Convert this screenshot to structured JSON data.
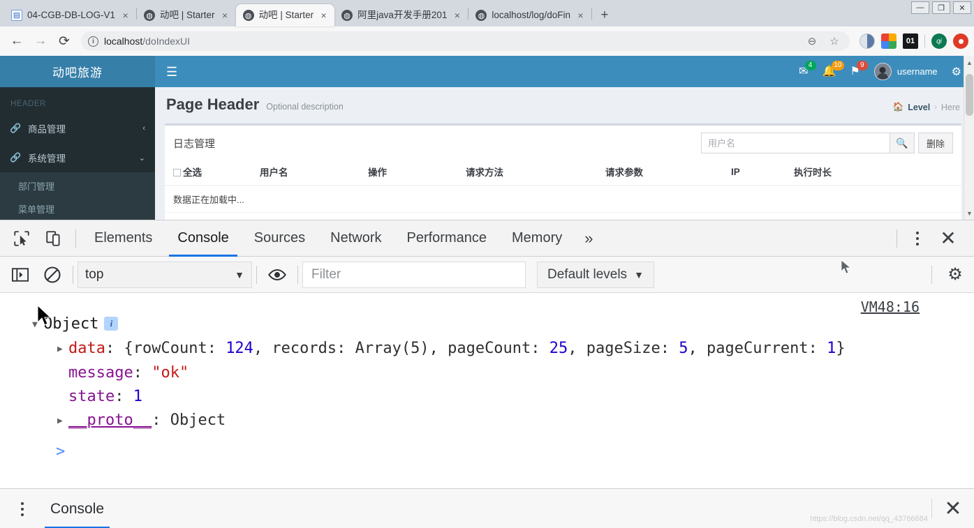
{
  "browser": {
    "tabs": [
      {
        "title": "04-CGB-DB-LOG-V1",
        "icon": "document-icon",
        "active": false
      },
      {
        "title": "动吧 | Starter",
        "icon": "globe-icon",
        "active": false
      },
      {
        "title": "动吧 | Starter",
        "icon": "globe-icon",
        "active": true
      },
      {
        "title": "阿里java开发手册201",
        "icon": "globe-icon",
        "active": false
      },
      {
        "title": "localhost/log/doFin",
        "icon": "globe-icon",
        "active": false
      }
    ],
    "new_tab_label": "+",
    "close_label": "×",
    "window_controls": {
      "minimize": "—",
      "maximize": "❐",
      "close": "✕"
    },
    "nav": {
      "back": "←",
      "forward": "→",
      "reload": "⟳"
    },
    "url": {
      "scheme_label": "i",
      "host": "localhost",
      "path": "/doIndexUI"
    },
    "url_actions": {
      "zoom_out": "search-minus",
      "bookmark": "star"
    },
    "extensions": [
      "moon-reader-icon",
      "google-photos-icon",
      "counter-01-icon",
      "qi-icon",
      "red-dot-icon"
    ]
  },
  "app": {
    "brand": "动吧旅游",
    "menu_toggle": "☰",
    "navbar_icons": [
      {
        "name": "messages-icon",
        "glyph": "✉",
        "badge": "4",
        "badge_color": "#00a65a"
      },
      {
        "name": "notifications-icon",
        "glyph": "🔔",
        "badge": "10",
        "badge_color": "#f39c12"
      },
      {
        "name": "tasks-icon",
        "glyph": "⚑",
        "badge": "9",
        "badge_color": "#dd4b39"
      }
    ],
    "username": "username",
    "settings_icon": "gear-icon",
    "sidebar": {
      "header": "HEADER",
      "items": [
        {
          "label": "商品管理",
          "icon": "link-icon",
          "chevron": "‹",
          "expanded": false
        },
        {
          "label": "系统管理",
          "icon": "link-icon",
          "chevron": "⌄",
          "expanded": true
        }
      ],
      "sub_items": [
        {
          "label": "部门管理"
        },
        {
          "label": "菜单管理"
        }
      ]
    },
    "content": {
      "title": "Page Header",
      "description": "Optional description",
      "breadcrumb": {
        "home_icon": "home-icon",
        "level": "Level",
        "separator": "›",
        "here": "Here"
      },
      "box_title": "日志管理",
      "search_placeholder": "用户名",
      "search_value": "",
      "search_icon": "search-icon",
      "delete_button": "删除",
      "table": {
        "columns": [
          "全选",
          "用户名",
          "操作",
          "请求方法",
          "请求参数",
          "IP",
          "执行时长"
        ],
        "loading_text": "数据正在加载中..."
      }
    }
  },
  "devtools": {
    "tools": {
      "inspect": "inspect-element-icon",
      "device": "device-toolbar-icon"
    },
    "tabs": [
      {
        "label": "Elements",
        "active": false
      },
      {
        "label": "Console",
        "active": true
      },
      {
        "label": "Sources",
        "active": false
      },
      {
        "label": "Network",
        "active": false
      },
      {
        "label": "Performance",
        "active": false
      },
      {
        "label": "Memory",
        "active": false
      }
    ],
    "more_tabs": "»",
    "close_label": "✕",
    "filterbar": {
      "sidebar_toggle": "console-sidebar-icon",
      "clear_console": "clear-console-icon",
      "context": "top",
      "context_caret": "▼",
      "eye_icon": "live-expression-icon",
      "filter_placeholder": "Filter",
      "filter_value": "",
      "levels": "Default levels",
      "levels_caret": "▼",
      "settings_icon": "gear-icon"
    },
    "console": {
      "source_link": "VM48:16",
      "root_expander": "▼",
      "root_label": "Object",
      "info_badge": "i",
      "rows": [
        {
          "expander": "▶",
          "key": "data",
          "colon": ":",
          "value": "{rowCount: 124, records: Array(5), pageCount: 25, pageSize: 5, pageCurrent: 1}",
          "parts": [
            {
              "t": "{rowCount: ",
              "c": "plain"
            },
            {
              "t": "124",
              "c": "num"
            },
            {
              "t": ", records: Array(5), pageCount: ",
              "c": "plain"
            },
            {
              "t": "25",
              "c": "num"
            },
            {
              "t": ", pageSize: ",
              "c": "plain"
            },
            {
              "t": "5",
              "c": "num"
            },
            {
              "t": ", pageCurrent: ",
              "c": "plain"
            },
            {
              "t": "1",
              "c": "num"
            },
            {
              "t": "}",
              "c": "plain"
            }
          ]
        },
        {
          "expander": "",
          "key": "message",
          "colon": ":",
          "parts": [
            {
              "t": "\"ok\"",
              "c": "str"
            }
          ]
        },
        {
          "expander": "",
          "key": "state",
          "colon": ":",
          "parts": [
            {
              "t": "1",
              "c": "num"
            }
          ]
        },
        {
          "expander": "▶",
          "key": "__proto__",
          "colon": ":",
          "parts": [
            {
              "t": "Object",
              "c": "plain"
            }
          ]
        }
      ],
      "prompt": ">"
    },
    "drawer": {
      "tab": "Console",
      "close_label": "✕"
    },
    "watermark": "https://blog.csdn.net/qq_43766684"
  }
}
